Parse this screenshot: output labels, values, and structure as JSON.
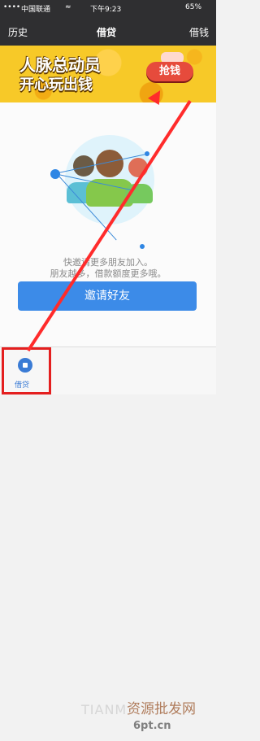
{
  "status": {
    "signal": "••••",
    "carrier": "中国联通",
    "wifi": "≈",
    "time": "下午9:23",
    "battery": "65%"
  },
  "nav": {
    "left": "历史",
    "title": "借贷",
    "right": "借钱"
  },
  "banner": {
    "line1": "人脉总动员",
    "line2": "开心玩出钱",
    "cta": "抢钱"
  },
  "content": {
    "desc1": "快邀请更多朋友加入。",
    "desc2": "朋友越多，借款额度更多哦。",
    "invite": "邀请好友"
  },
  "tab": {
    "label": "借贷"
  },
  "watermark": {
    "w1": "TIANM",
    "w2": "资源批发网",
    "w3": "6pt.cn"
  }
}
